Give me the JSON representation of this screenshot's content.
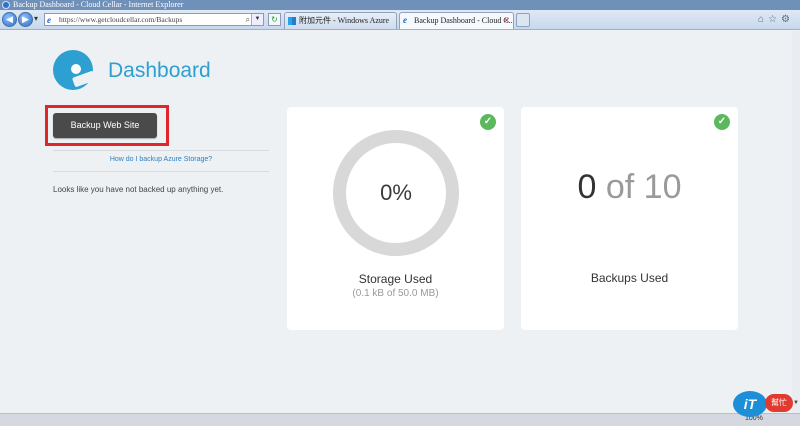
{
  "browser": {
    "window_title": "Backup Dashboard - Cloud Cellar - Internet Explorer",
    "address_url": "https://www.getcloudcellar.com/Backups",
    "tabs": [
      {
        "label": "附加元件 - Windows Azure"
      },
      {
        "label": "Backup Dashboard - Cloud C..."
      }
    ],
    "zoom": "100%"
  },
  "page": {
    "title": "Dashboard",
    "backup_button_label": "Backup Web Site",
    "help_link": "How do I backup Azure Storage?",
    "empty_message": "Looks like you have not backed up anything yet."
  },
  "storage_card": {
    "percent_label": "0%",
    "percent_value": 0,
    "title": "Storage Used",
    "subtitle": "(0.1 kB of 50.0 MB)"
  },
  "backups_card": {
    "used": "0",
    "of_total": "of 10",
    "title": "Backups Used"
  },
  "watermark": {
    "left_text": "iT",
    "right_text": "幫忙"
  },
  "colors": {
    "brand_blue": "#2d9fd0",
    "highlight_red": "#e1252c",
    "check_green": "#5cb85c",
    "button_dark": "#4a4a4a"
  }
}
